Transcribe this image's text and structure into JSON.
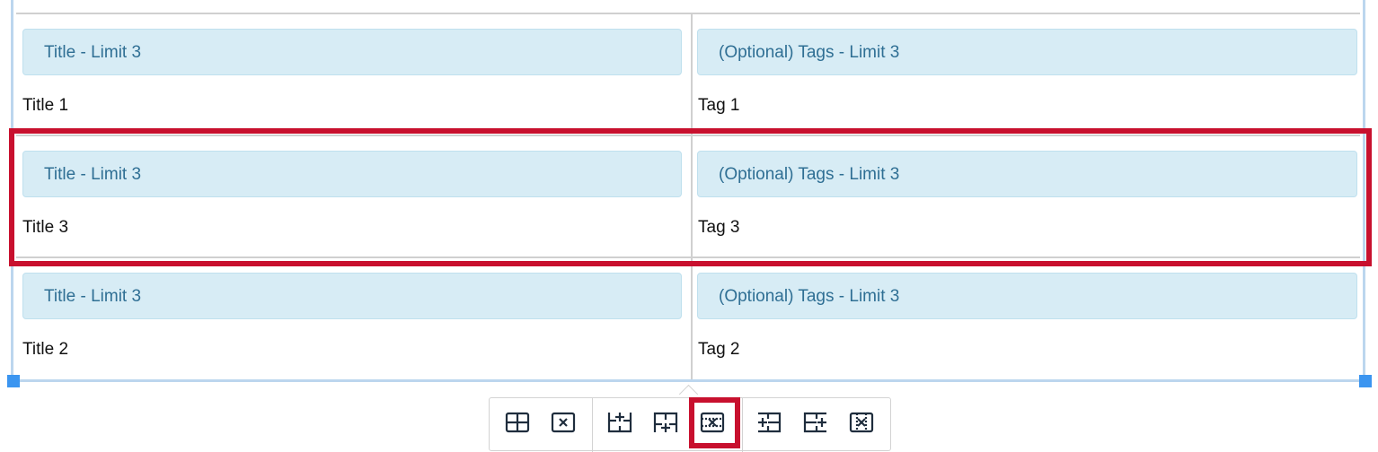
{
  "table": {
    "rows": [
      {
        "title_label": "Title - Limit 3",
        "title_value": "Title 1",
        "tags_label": "(Optional) Tags - Limit 3",
        "tags_value": "Tag 1"
      },
      {
        "title_label": "Title - Limit 3",
        "title_value": "Title 3",
        "tags_label": "(Optional) Tags - Limit 3",
        "tags_value": "Tag 3"
      },
      {
        "title_label": "Title - Limit 3",
        "title_value": "Title 2",
        "tags_label": "(Optional) Tags - Limit 3",
        "tags_value": "Tag 2"
      }
    ],
    "highlighted_row_index": 1
  },
  "toolbar": {
    "buttons": [
      {
        "icon": "table-properties-icon"
      },
      {
        "icon": "delete-table-icon"
      },
      {
        "icon": "insert-row-before-icon"
      },
      {
        "icon": "insert-row-after-icon"
      },
      {
        "icon": "delete-row-icon",
        "highlighted": true
      },
      {
        "icon": "insert-column-before-icon"
      },
      {
        "icon": "insert-column-after-icon"
      },
      {
        "icon": "delete-column-icon"
      }
    ]
  },
  "colors": {
    "highlight": "#c8102e",
    "label_bg": "#d7ecf5",
    "label_text": "#2f6f94",
    "selection_border": "#bcd6ee",
    "handle": "#3b95f0",
    "icon": "#1f2d3d"
  }
}
